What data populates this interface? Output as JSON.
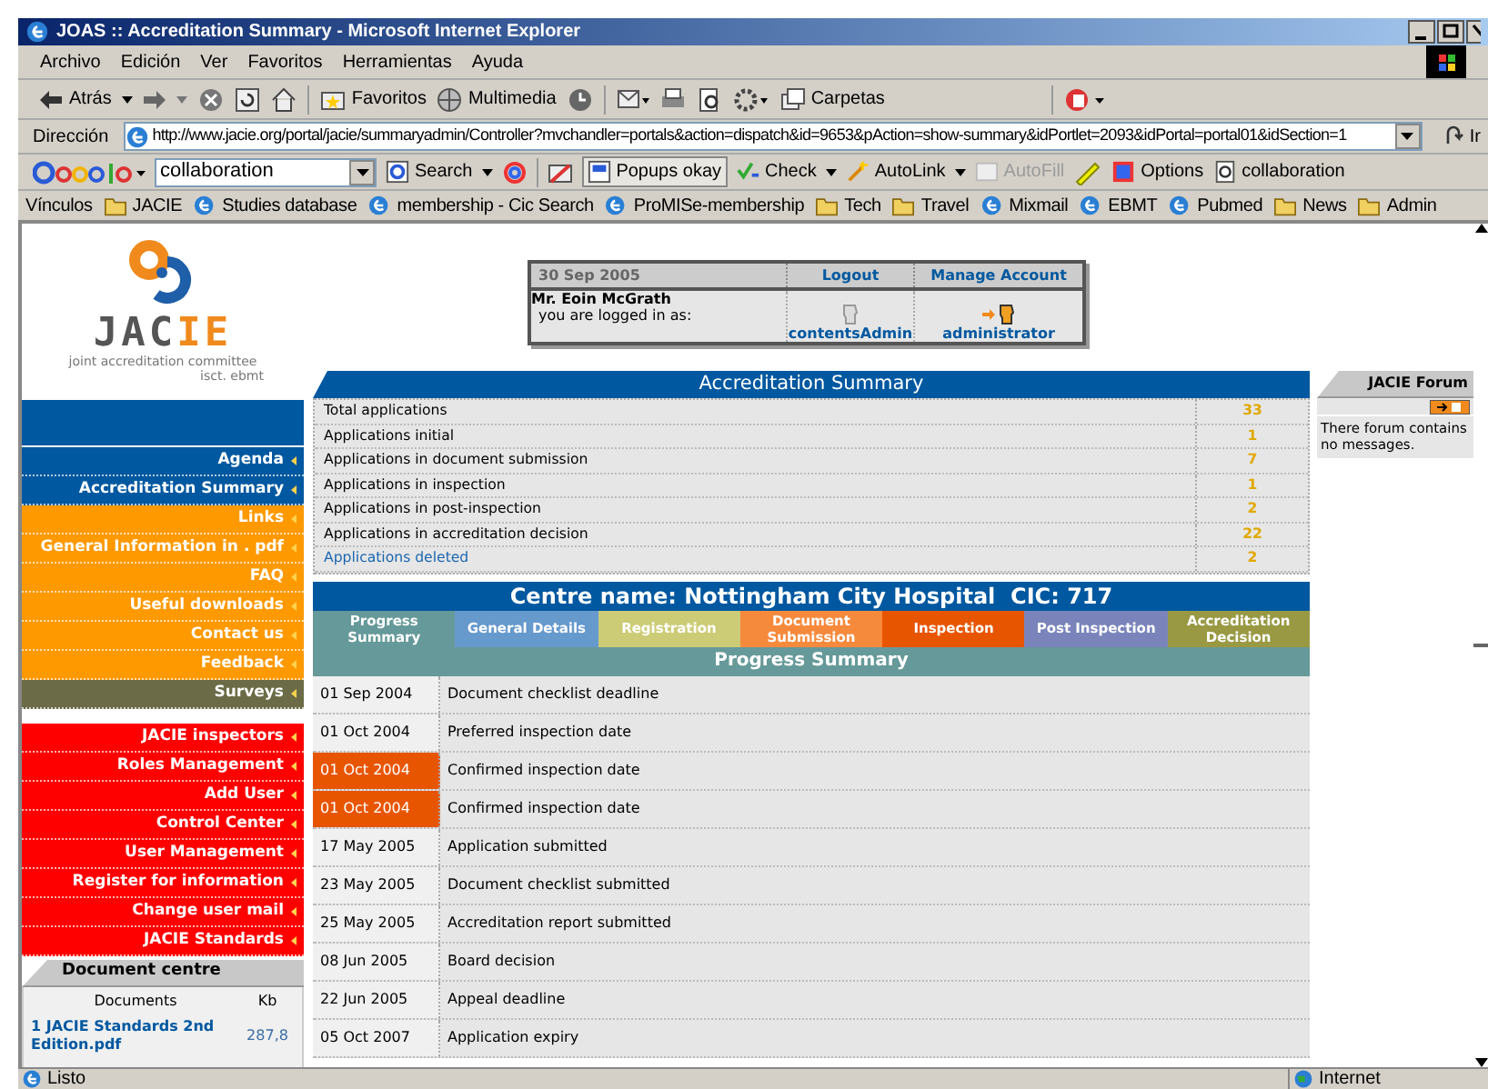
{
  "window": {
    "title": "JOAS :: Accreditation Summary - Microsoft Internet Explorer"
  },
  "menu": [
    "Archivo",
    "Edición",
    "Ver",
    "Favoritos",
    "Herramientas",
    "Ayuda"
  ],
  "toolbar": {
    "back": "Atrás",
    "favorites": "Favoritos",
    "media": "Multimedia",
    "folders": "Carpetas"
  },
  "address": {
    "label": "Dirección",
    "value": "http://www.jacie.org/portal/jacie/summaryadmin/Controller?mvchandler=portals&action=dispatch&id=9653&pAction=show-summary&idPortlet=2093&idPortal=portal01&idSection=1",
    "go": "Ir"
  },
  "google_bar": {
    "query": "collaboration",
    "buttons": [
      {
        "label": "Search",
        "disabled": false
      },
      {
        "label": "Popups okay",
        "disabled": false
      },
      {
        "label": "Check",
        "disabled": false
      },
      {
        "label": "AutoLink",
        "disabled": false
      },
      {
        "label": "AutoFill",
        "disabled": true
      },
      {
        "label": "Options",
        "disabled": false
      },
      {
        "label": "collaboration",
        "disabled": false
      }
    ]
  },
  "links_bar": {
    "label": "Vínculos",
    "items": [
      {
        "label": "JACIE",
        "kind": "folder"
      },
      {
        "label": "Studies database",
        "kind": "page"
      },
      {
        "label": "membership - Cic Search",
        "kind": "page"
      },
      {
        "label": "ProMISe-membership",
        "kind": "page"
      },
      {
        "label": "Tech",
        "kind": "folder"
      },
      {
        "label": "Travel",
        "kind": "folder"
      },
      {
        "label": "Mixmail",
        "kind": "page"
      },
      {
        "label": "EBMT",
        "kind": "page"
      },
      {
        "label": "Pubmed",
        "kind": "page"
      },
      {
        "label": "News",
        "kind": "folder"
      },
      {
        "label": "Admin",
        "kind": "folder"
      }
    ]
  },
  "logo": {
    "wordmark_left": "JAC",
    "wordmark_right": "IE",
    "tagline_1": "joint accreditation committee",
    "tagline_2": "isct. ebmt"
  },
  "sidebar": {
    "items": [
      {
        "label": "Agenda",
        "color": "#0058a0"
      },
      {
        "label": "Accreditation Summary",
        "color": "#0058a0"
      },
      {
        "label": "Links",
        "color": "#ff9900"
      },
      {
        "label": "General Information in . pdf",
        "color": "#ff9900"
      },
      {
        "label": "FAQ",
        "color": "#ff9900"
      },
      {
        "label": "Useful downloads",
        "color": "#ff9900"
      },
      {
        "label": "Contact us",
        "color": "#ff9900"
      },
      {
        "label": "Feedback",
        "color": "#ff9900"
      },
      {
        "label": "Surveys",
        "color": "#6b6b47"
      }
    ],
    "admin_items": [
      "JACIE inspectors",
      "Roles Management",
      "Add User",
      "Control Center",
      "User Management",
      "Register for information",
      "Change user mail",
      "JACIE Standards"
    ]
  },
  "document_centre": {
    "title": "Document centre",
    "columns": [
      "Documents",
      "Kb"
    ],
    "rows": [
      {
        "document": "1 JACIE Standards 2nd Edition.pdf",
        "size": "287,8"
      }
    ]
  },
  "user_box": {
    "date": "30 Sep 2005",
    "logout": "Logout",
    "manage_account": "Manage Account",
    "name": "Mr. Eoin McGrath",
    "logged_in_as": "you are logged in as:",
    "roles": [
      {
        "label": "contentsAdmin",
        "selected": false
      },
      {
        "label": "administrator",
        "selected": true
      }
    ]
  },
  "summary": {
    "title": "Accreditation Summary",
    "rows": [
      {
        "label": "Total applications",
        "value": "33",
        "link": false
      },
      {
        "label": "Applications initial",
        "value": "1",
        "link": false
      },
      {
        "label": "Applications in document submission",
        "value": "7",
        "link": false
      },
      {
        "label": "Applications in inspection",
        "value": "1",
        "link": false
      },
      {
        "label": "Applications in post-inspection",
        "value": "2",
        "link": false
      },
      {
        "label": "Applications in accreditation decision",
        "value": "22",
        "link": false
      },
      {
        "label": "Applications deleted",
        "value": "2",
        "link": true
      }
    ]
  },
  "centre": {
    "name": "Centre name: Nottingham City Hospital  CIC: 717"
  },
  "stages": [
    {
      "label": "Progress Summary",
      "color": "#669999"
    },
    {
      "label": "General Details",
      "color": "#6699cc"
    },
    {
      "label": "Registration",
      "color": "#cccc77"
    },
    {
      "label": "Document Submission",
      "color": "#f68a3c"
    },
    {
      "label": "Inspection",
      "color": "#e85500"
    },
    {
      "label": "Post Inspection",
      "color": "#7a84bb"
    },
    {
      "label": "Accreditation Decision",
      "color": "#999944"
    }
  ],
  "progress": {
    "title": "Progress Summary",
    "rows": [
      {
        "date": "01 Sep 2004",
        "event": "Document checklist deadline",
        "highlighted": false
      },
      {
        "date": "01 Oct 2004",
        "event": "Preferred inspection date",
        "highlighted": false
      },
      {
        "date": "01 Oct 2004",
        "event": "Confirmed inspection date",
        "highlighted": true
      },
      {
        "date": "01 Oct 2004",
        "event": "Confirmed inspection date",
        "highlighted": true
      },
      {
        "date": "17 May 2005",
        "event": "Application submitted",
        "highlighted": false
      },
      {
        "date": "23 May 2005",
        "event": "Document checklist submitted",
        "highlighted": false
      },
      {
        "date": "25 May 2005",
        "event": "Accreditation report submitted",
        "highlighted": false
      },
      {
        "date": "08 Jun 2005",
        "event": "Board decision",
        "highlighted": false
      },
      {
        "date": "22 Jun 2005",
        "event": "Appeal deadline",
        "highlighted": false
      },
      {
        "date": "05 Oct 2007",
        "event": "Application expiry",
        "highlighted": false
      }
    ]
  },
  "forum": {
    "title": "JACIE Forum",
    "message": "There forum contains no messages."
  },
  "status_bar": {
    "text": "Listo",
    "zone": "Internet"
  }
}
